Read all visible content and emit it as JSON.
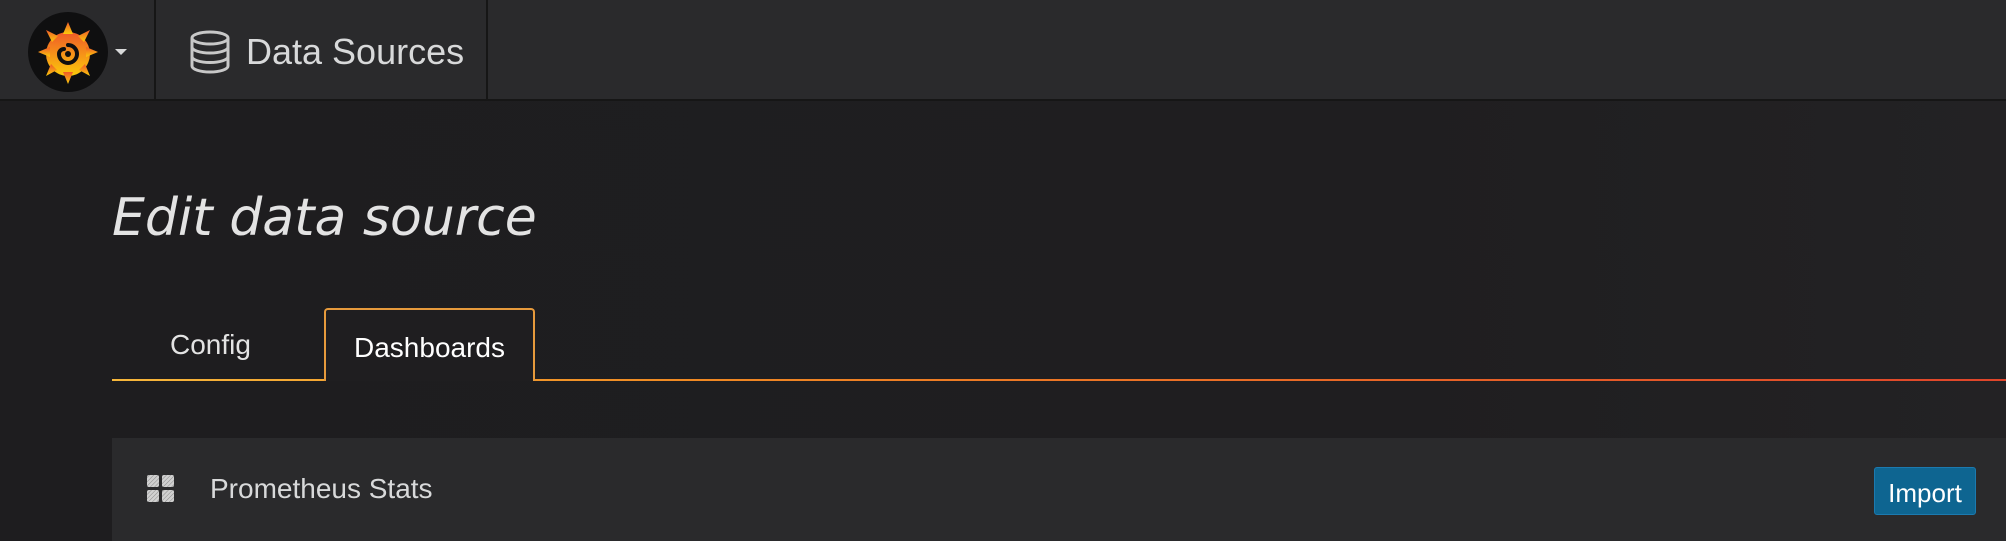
{
  "navbar": {
    "logo_icon": "grafana-logo-icon",
    "menu_caret_icon": "caret-down-icon",
    "section_icon": "database-icon",
    "section_title": "Data Sources"
  },
  "page": {
    "title": "Edit data source"
  },
  "tabs": [
    {
      "label": "Config",
      "active": false
    },
    {
      "label": "Dashboards",
      "active": true
    }
  ],
  "dashboards": [
    {
      "icon": "dashboard-grid-icon",
      "name": "Prometheus Stats",
      "action_label": "Import"
    }
  ],
  "colors": {
    "accent_orange": "#f08a23",
    "import_blue": "#0e6591",
    "navbar_bg": "#2a2a2c",
    "page_bg": "#1f1e20"
  }
}
